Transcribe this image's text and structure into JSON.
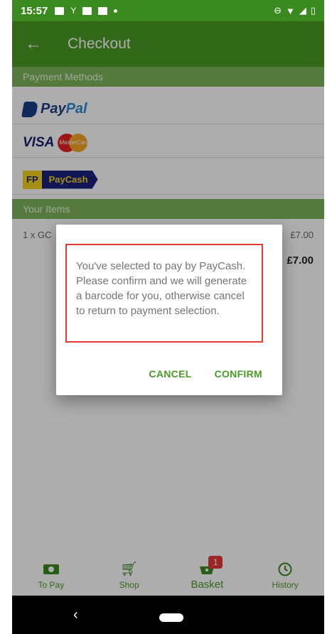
{
  "status_bar": {
    "time": "15:57"
  },
  "app_bar": {
    "title": "Checkout",
    "back_icon": "arrow-back-icon"
  },
  "payment_methods": {
    "header": "Payment Methods",
    "paypal": {
      "pay": "Pay",
      "pal": "Pal"
    },
    "visa": {
      "visa": "VISA",
      "mastercard": "MasterCard"
    },
    "paycash": {
      "fp": "FP",
      "name": "PayCash"
    }
  },
  "items": {
    "header": "Your Items",
    "rows": [
      {
        "qty_name": "1 x GC",
        "price": "£7.00"
      }
    ],
    "total": "£7.00"
  },
  "dialog": {
    "message": "You've selected to pay by PayCash. Please confirm and we will generate a barcode for you, otherwise cancel to return to payment selection.",
    "cancel_label": "CANCEL",
    "confirm_label": "CONFIRM",
    "accent": "#4a9b26"
  },
  "bottom_nav": {
    "items": [
      {
        "label": "To Pay",
        "icon": "money-icon"
      },
      {
        "label": "Shop",
        "icon": "cart-icon"
      },
      {
        "label": "Basket",
        "icon": "basket-icon",
        "badge": "1"
      },
      {
        "label": "History",
        "icon": "history-icon"
      }
    ]
  },
  "colors": {
    "primary": "#4a9b26",
    "status_bar": "#3b8a1f",
    "badge": "#e53935"
  }
}
